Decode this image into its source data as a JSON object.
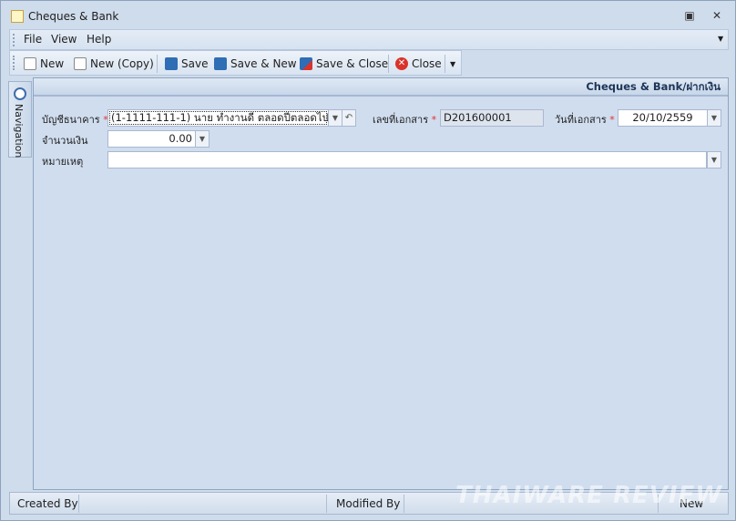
{
  "window": {
    "title": "Cheques & Bank",
    "minimize_icon": "restore-icon",
    "close_icon": "close-icon"
  },
  "menu": [
    "File",
    "View",
    "Help"
  ],
  "toolbar": {
    "new": "New",
    "new_copy": "New (Copy)",
    "save": "Save",
    "save_new": "Save & New",
    "save_close": "Save & Close",
    "close": "Close"
  },
  "nav": {
    "label": "Navigation"
  },
  "panel": {
    "header": "Cheques & Bank/ฝากเงิน"
  },
  "form": {
    "bank_account_label": "บัญชีธนาคาร",
    "bank_account_value": "(1-1111-111-1) นาย ทำงานดี ตลอดปีตลอดไป",
    "doc_no_label": "เลขที่เอกสาร",
    "doc_no_value": "D201600001",
    "doc_date_label": "วันที่เอกสาร",
    "doc_date_value": "20/10/2559",
    "amount_label": "จำนวนเงิน",
    "amount_value": "0.00",
    "note_label": "หมายเหตุ",
    "note_value": "",
    "required_mark": "*"
  },
  "status": {
    "created_by": "Created By",
    "modified_by": "Modified By",
    "state": "New"
  },
  "watermark": "THAIWARE REVIEW",
  "colors": {
    "close_red": "#d9342b",
    "save_blue": "#2f6db5"
  }
}
